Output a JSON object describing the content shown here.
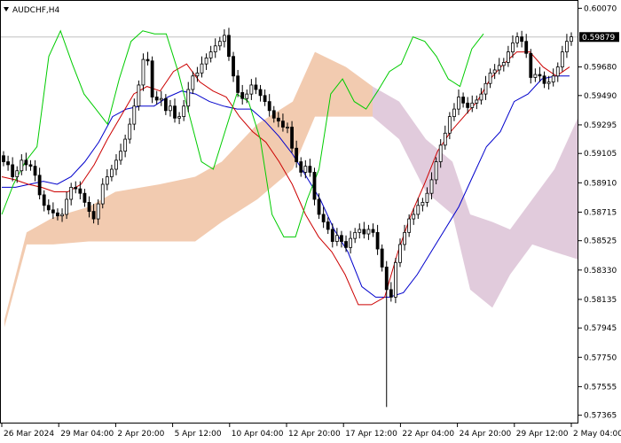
{
  "window": {
    "symbol_label": "AUDCHF,H4"
  },
  "colors": {
    "background": "#ffffff",
    "candle": "#000000",
    "tenkan": "#cc0000",
    "kijun": "#0000cc",
    "chikou": "#00cc00",
    "kumo_bull": "#e8a070",
    "kumo_bear": "#c8a0c0",
    "price_line": "#c0c0c0",
    "price_tag_bg": "#000000"
  },
  "chart_data": {
    "type": "candlestick",
    "title": "AUDCHF,H4",
    "indicator": "Ichimoku Kinko Hyo",
    "current_price": "0.59879",
    "y_tick_labels": [
      "0.60070",
      "0.59680",
      "0.59490",
      "0.59295",
      "0.59105",
      "0.58910",
      "0.58715",
      "0.58525",
      "0.58330",
      "0.58135",
      "0.57945",
      "0.57750",
      "0.57555",
      "0.57365"
    ],
    "y_ticks": [
      0.6007,
      0.5968,
      0.5949,
      0.59295,
      0.59105,
      0.5891,
      0.58715,
      0.58525,
      0.5833,
      0.58135,
      0.57945,
      0.5775,
      0.57555,
      0.57365
    ],
    "ylim": [
      0.5731,
      0.60125
    ],
    "x_tick_labels": [
      "26 Mar 2024",
      "29 Mar 04:00",
      "2 Apr 20:00",
      "5 Apr 12:00",
      "10 Apr 04:00",
      "12 Apr 20:00",
      "17 Apr 12:00",
      "22 Apr 04:00",
      "24 Apr 20:00",
      "29 Apr 12:00",
      "2 May 04:00"
    ],
    "candles_estimated_close": [
      0.5905,
      0.5903,
      0.5895,
      0.5899,
      0.5906,
      0.5903,
      0.5902,
      0.5896,
      0.5883,
      0.5876,
      0.5873,
      0.5871,
      0.5869,
      0.587,
      0.588,
      0.5888,
      0.5887,
      0.5884,
      0.5878,
      0.5872,
      0.5867,
      0.5877,
      0.589,
      0.5895,
      0.59,
      0.5906,
      0.5912,
      0.592,
      0.593,
      0.5942,
      0.5956,
      0.5973,
      0.5972,
      0.5948,
      0.5946,
      0.5947,
      0.5939,
      0.5942,
      0.5934,
      0.5935,
      0.5942,
      0.5953,
      0.5962,
      0.5964,
      0.597,
      0.5974,
      0.5978,
      0.5982,
      0.5985,
      0.5989,
      0.5975,
      0.5962,
      0.5951,
      0.5947,
      0.595,
      0.5956,
      0.5953,
      0.5949,
      0.5945,
      0.5939,
      0.5934,
      0.5932,
      0.5928,
      0.5928,
      0.5914,
      0.5905,
      0.5898,
      0.5902,
      0.5898,
      0.588,
      0.587,
      0.5865,
      0.586,
      0.5852,
      0.5856,
      0.5852,
      0.5848,
      0.5854,
      0.5858,
      0.586,
      0.5857,
      0.586,
      0.5858,
      0.5847,
      0.5835,
      0.582,
      0.5815,
      0.5838,
      0.585,
      0.5858,
      0.5867,
      0.587,
      0.5876,
      0.5878,
      0.5884,
      0.5893,
      0.5905,
      0.5916,
      0.5924,
      0.5935,
      0.594,
      0.5948,
      0.5944,
      0.5941,
      0.5944,
      0.5946,
      0.595,
      0.5957,
      0.5964,
      0.5966,
      0.5969,
      0.5971,
      0.5978,
      0.5984,
      0.5988,
      0.5985,
      0.5977,
      0.5961,
      0.5963,
      0.5962,
      0.5957,
      0.5958,
      0.5962,
      0.5968,
      0.5978,
      0.5985,
      0.5988
    ],
    "tenkan_estimated": [
      0.5895,
      0.5893,
      0.589,
      0.5888,
      0.5885,
      0.5885,
      0.589,
      0.5903,
      0.592,
      0.5935,
      0.595,
      0.5955,
      0.5952,
      0.5965,
      0.597,
      0.5958,
      0.5952,
      0.5948,
      0.5935,
      0.5925,
      0.5918,
      0.5905,
      0.589,
      0.587,
      0.5855,
      0.5845,
      0.583,
      0.581,
      0.581,
      0.5815,
      0.5845,
      0.587,
      0.589,
      0.5912,
      0.5925,
      0.5935,
      0.5945,
      0.596,
      0.597,
      0.5978,
      0.5978,
      0.5968,
      0.5962,
      0.5968
    ],
    "kijun_estimated": [
      0.5888,
      0.5888,
      0.589,
      0.5892,
      0.589,
      0.5895,
      0.5905,
      0.5918,
      0.5935,
      0.594,
      0.5942,
      0.5942,
      0.5948,
      0.5952,
      0.595,
      0.5945,
      0.5942,
      0.594,
      0.594,
      0.5932,
      0.5922,
      0.591,
      0.5895,
      0.588,
      0.586,
      0.5845,
      0.5822,
      0.5815,
      0.5815,
      0.5818,
      0.583,
      0.5845,
      0.586,
      0.5875,
      0.5895,
      0.5915,
      0.5925,
      0.5945,
      0.595,
      0.596,
      0.5962,
      0.5962
    ]
  }
}
